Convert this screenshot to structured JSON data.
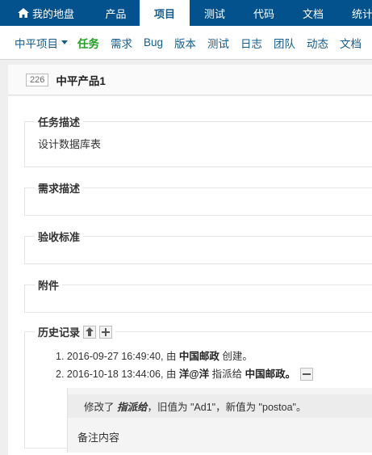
{
  "topnav": {
    "items": [
      {
        "label": "我的地盘"
      },
      {
        "label": "产品"
      },
      {
        "label": "项目"
      },
      {
        "label": "测试"
      },
      {
        "label": "代码"
      },
      {
        "label": "文档"
      },
      {
        "label": "统计"
      }
    ],
    "active_index": 2
  },
  "subnav": {
    "project_label": "中平项目",
    "items": [
      {
        "label": "任务"
      },
      {
        "label": "需求"
      },
      {
        "label": "Bug"
      },
      {
        "label": "版本"
      },
      {
        "label": "测试"
      },
      {
        "label": "日志"
      },
      {
        "label": "团队"
      },
      {
        "label": "动态"
      },
      {
        "label": "文档"
      }
    ]
  },
  "task": {
    "id": "226",
    "title": "中平产品1"
  },
  "sections": {
    "task_desc": {
      "title": "任务描述",
      "content": "设计数据库表"
    },
    "story_desc": {
      "title": "需求描述",
      "content": ""
    },
    "acceptance": {
      "title": "验收标准",
      "content": ""
    },
    "attachments": {
      "title": "附件",
      "content": ""
    }
  },
  "history": {
    "title": "历史记录",
    "entries": [
      {
        "number": "1.",
        "time": "2016-09-27 16:49:40",
        "by": ", 由 ",
        "actor": "中国邮政",
        "action": " 创建。",
        "target": ""
      },
      {
        "number": "2.",
        "time": "2016-10-18 13:44:06",
        "by": ", 由 ",
        "actor": "洋@洋",
        "action": " 指派给 ",
        "target": "中国邮政。"
      }
    ],
    "change": {
      "prefix": "修改了 ",
      "field": "指派给",
      "middle": "，旧值为 \"Ad1\"，新值为 \"postoa\"。"
    },
    "comment": "备注内容"
  },
  "colors": {
    "nav_bg": "#03528d",
    "link": "#145c8c",
    "active_sub": "#229f24"
  }
}
